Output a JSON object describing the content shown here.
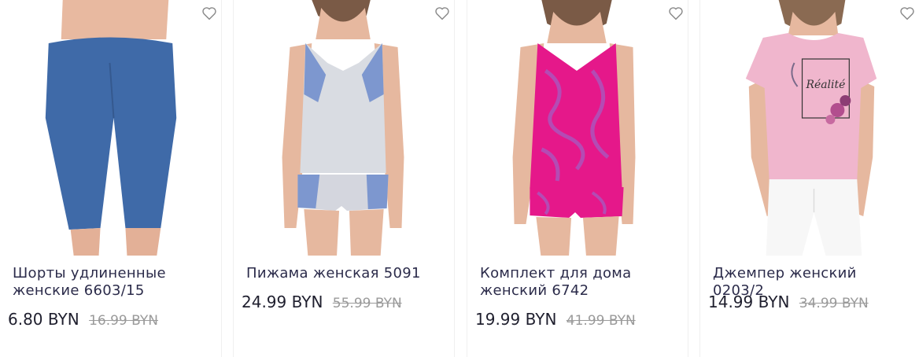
{
  "products": [
    {
      "title_line1": "Шорты удлиненные",
      "title_line2": "женские 6603/15",
      "price": "6.80 BYN",
      "old_price": "16.99 BYN",
      "photo_icon": "blue-leggings-photo",
      "fav_icon": "heart-outline-icon"
    },
    {
      "title_line1": "Пижама женская 5091",
      "title_line2": "",
      "price": "24.99 BYN",
      "old_price": "55.99 BYN",
      "photo_icon": "grey-pajama-photo",
      "fav_icon": "heart-outline-icon"
    },
    {
      "title_line1": "Комплект для дома",
      "title_line2": "женский 6742",
      "price": "19.99 BYN",
      "old_price": "41.99 BYN",
      "photo_icon": "pink-set-photo",
      "fav_icon": "heart-outline-icon"
    },
    {
      "title_line1": "Джемпер женский 0203/2",
      "title_line2": "",
      "price": "14.99 BYN",
      "old_price": "34.99 BYN",
      "photo_icon": "pink-tshirt-photo",
      "tshirt_print": "Réalité",
      "fav_icon": "heart-outline-icon"
    }
  ],
  "colors": {
    "title": "#2b2b4a",
    "price": "#1f1f2e",
    "old_price": "#9a9a9a"
  }
}
